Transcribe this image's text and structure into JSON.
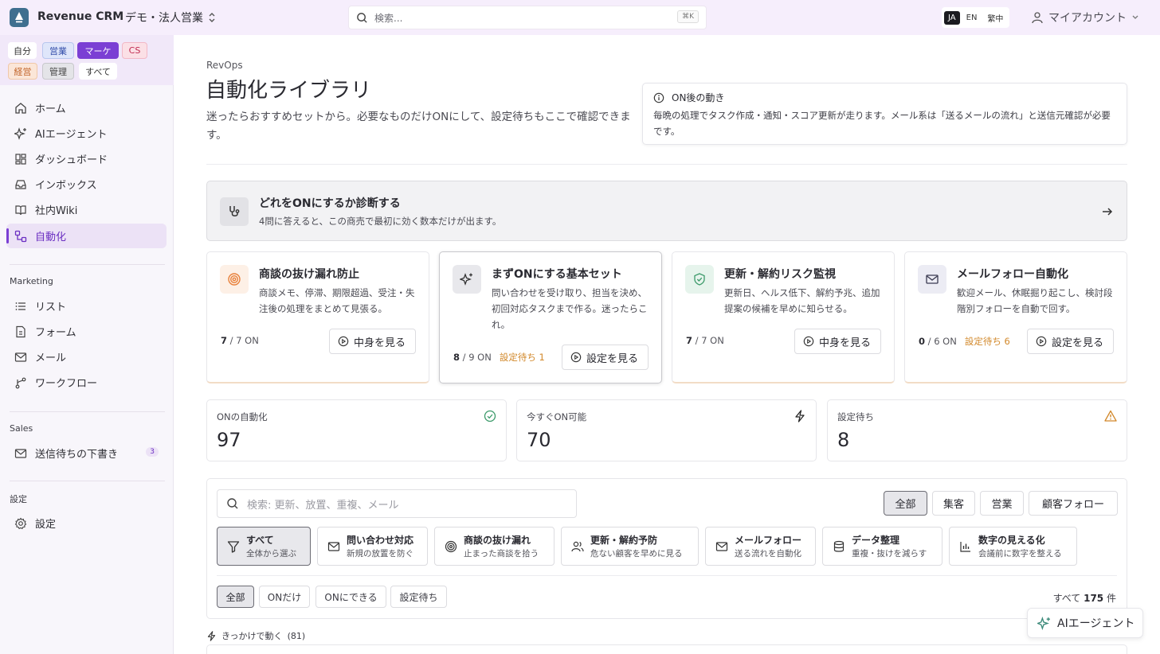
{
  "app": {
    "title": "Revenue CRM",
    "workspace": "デモ・法人営業"
  },
  "header": {
    "search_placeholder": "検索...",
    "search_shortcut": "⌘K",
    "languages": [
      "JA",
      "EN",
      "繁中"
    ],
    "active_language": "JA",
    "account_label": "マイアカウント"
  },
  "roles": [
    "自分",
    "営業",
    "マーケ",
    "CS",
    "経営",
    "管理",
    "すべて"
  ],
  "active_role": "マーケ",
  "sidebar": {
    "main": [
      {
        "label": "ホーム",
        "icon": "home-icon"
      },
      {
        "label": "AIエージェント",
        "icon": "sparkles-icon"
      },
      {
        "label": "ダッシュボード",
        "icon": "grid-icon"
      },
      {
        "label": "インボックス",
        "icon": "inbox-icon"
      },
      {
        "label": "社内Wiki",
        "icon": "book-icon"
      },
      {
        "label": "自動化",
        "icon": "workflow-icon",
        "active": true
      }
    ],
    "marketing_title": "Marketing",
    "marketing": [
      {
        "label": "リスト",
        "icon": "list-icon"
      },
      {
        "label": "フォーム",
        "icon": "file-icon"
      },
      {
        "label": "メール",
        "icon": "mail-icon"
      },
      {
        "label": "ワークフロー",
        "icon": "branch-icon"
      }
    ],
    "sales_title": "Sales",
    "sales": [
      {
        "label": "送信待ちの下書き",
        "icon": "mail-icon",
        "badge": "3"
      }
    ],
    "settings_title": "設定",
    "settings": [
      {
        "label": "設定",
        "icon": "gear-icon"
      }
    ]
  },
  "page": {
    "breadcrumb": "RevOps",
    "title": "自動化ライブラリ",
    "description": "迷ったらおすすめセットから。必要なものだけONにして、設定待ちもここで確認できます。",
    "note_title": "ON後の動き",
    "note_body": "毎晩の処理でタスク作成・通知・スコア更新が走ります。メール系は「送るメールの流れ」と送信元確認が必要です。",
    "diagnose_title": "どれをONにするか診断する",
    "diagnose_sub": "4問に答えると、この商売で最初に効く数本だけが出ます。"
  },
  "cards": [
    {
      "title": "商談の抜け漏れ防止",
      "desc": "商談メモ、停滞、期限超過、受注・失注後の処理をまとめて見張る。",
      "on": "7",
      "total": "/ 7 ON",
      "pending": "",
      "button": "中身を見る",
      "icon": "target-icon",
      "accent": "#f0a060"
    },
    {
      "title": "まずONにする基本セット",
      "desc": "問い合わせを受け取り、担当を決め、初回対応タスクまで作る。迷ったらこれ。",
      "on": "8",
      "total": "/ 9 ON",
      "pending": "設定待ち 1",
      "button": "設定を見る",
      "icon": "sparkles-icon",
      "accent": "#3a3a40"
    },
    {
      "title": "更新・解約リスク監視",
      "desc": "更新日、ヘルス低下、解約予兆、追加提案の候補を早めに知らせる。",
      "on": "7",
      "total": "/ 7 ON",
      "pending": "",
      "button": "中身を見る",
      "icon": "shield-check-icon",
      "accent": "#3c9a6a"
    },
    {
      "title": "メールフォロー自動化",
      "desc": "歓迎メール、休眠掘り起こし、検討段階別フォローを自動で回す。",
      "on": "0",
      "total": "/ 6 ON",
      "pending": "設定待ち 6",
      "button": "設定を見る",
      "icon": "mail-icon",
      "accent": "#4a4a70"
    }
  ],
  "stats": [
    {
      "label": "ONの自動化",
      "value": "97",
      "icon": "check-circle-icon",
      "color": "#3c9a6a"
    },
    {
      "label": "今すぐON可能",
      "value": "70",
      "icon": "bolt-icon",
      "color": "#2a2a31"
    },
    {
      "label": "設定待ち",
      "value": "8",
      "icon": "warning-icon",
      "color": "#d2882a"
    }
  ],
  "filters": {
    "search_placeholder": "検索: 更新、放置、重複、メール",
    "segments": [
      "全部",
      "集客",
      "営業",
      "顧客フォロー"
    ],
    "active_segment": "全部",
    "categories": [
      {
        "title": "すべて",
        "sub": "全体から選ぶ",
        "icon": "filter-icon"
      },
      {
        "title": "問い合わせ対応",
        "sub": "新規の放置を防ぐ",
        "icon": "mail-icon"
      },
      {
        "title": "商談の抜け漏れ",
        "sub": "止まった商談を拾う",
        "icon": "target-icon"
      },
      {
        "title": "更新・解約予防",
        "sub": "危ない顧客を早めに見る",
        "icon": "users-icon"
      },
      {
        "title": "メールフォロー",
        "sub": "送る流れを自動化",
        "icon": "mail-icon"
      },
      {
        "title": "データ整理",
        "sub": "重複・抜けを減らす",
        "icon": "database-icon"
      },
      {
        "title": "数字の見える化",
        "sub": "会議前に数字を整える",
        "icon": "chart-icon"
      }
    ],
    "active_category": "すべて",
    "states": [
      "全部",
      "ONだけ",
      "ONにできる",
      "設定待ち"
    ],
    "active_state": "全部",
    "total_prefix": "すべて",
    "total_count": "175",
    "total_suffix": "件"
  },
  "trigger_section": {
    "label": "きっかけで動く",
    "count": "(81)"
  },
  "agent_button": "AIエージェント"
}
